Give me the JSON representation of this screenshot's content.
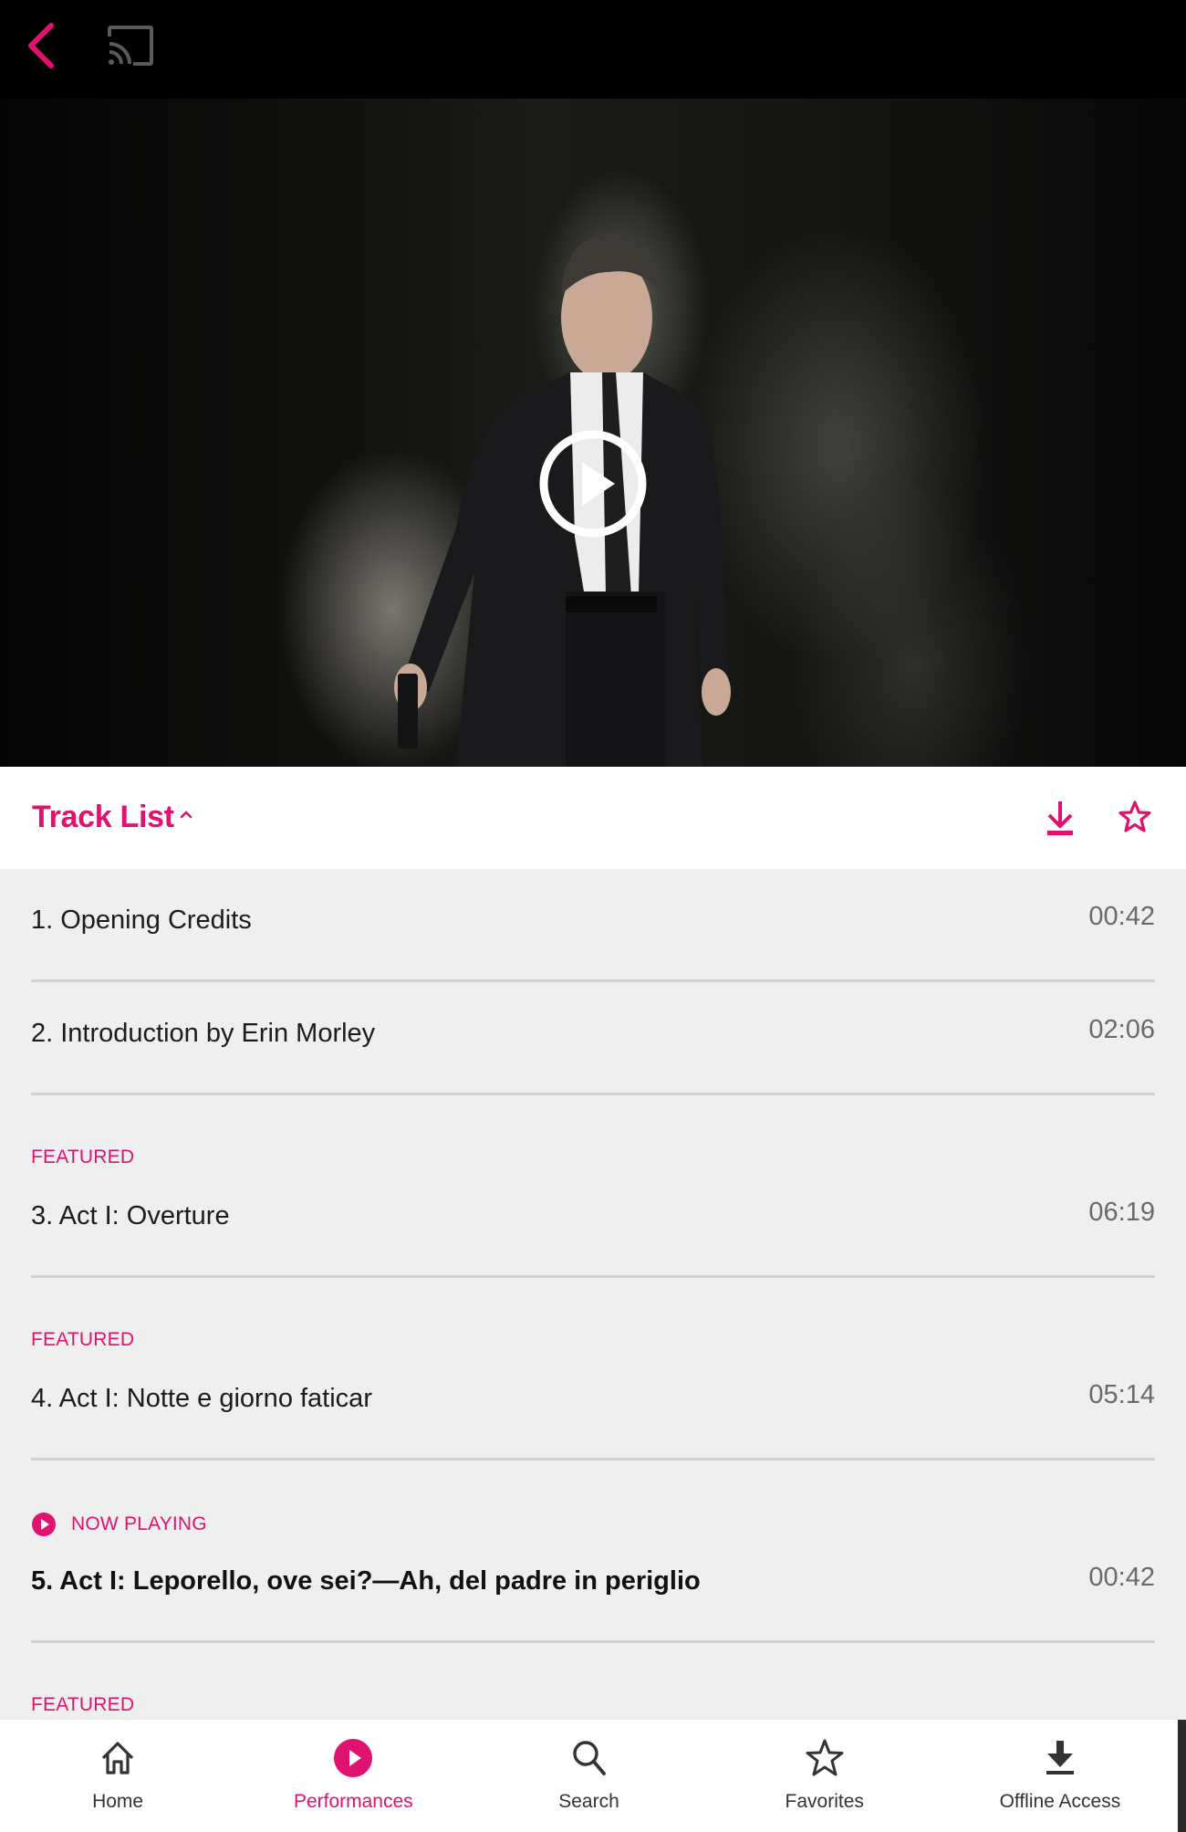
{
  "topbar": {
    "back_icon": "chevron-left-icon",
    "cast_icon": "cast-icon"
  },
  "hero": {
    "description": "Stage photo: man in dark suit holding a pistol amid smoke",
    "play_icon": "play-circle-icon"
  },
  "tracklist": {
    "title": "Track List",
    "expanded": true,
    "download_icon": "download-icon",
    "favorite_icon": "star-outline-icon",
    "tracks": [
      {
        "label": "1. Opening Credits",
        "duration": "00:42",
        "tag": ""
      },
      {
        "label": "2. Introduction by Erin Morley",
        "duration": "02:06",
        "tag": ""
      },
      {
        "label": "3. Act I: Overture",
        "duration": "06:19",
        "tag": "Featured"
      },
      {
        "label": "4. Act I: Notte e giorno faticar",
        "duration": "05:14",
        "tag": "Featured"
      },
      {
        "label": "5. Act I: Leporello, ove sei?—Ah, del padre in periglio",
        "duration": "00:42",
        "tag": "Now Playing",
        "now_playing": true
      },
      {
        "label": "",
        "duration": "",
        "tag": "Featured"
      }
    ]
  },
  "bottom_nav": {
    "items": [
      {
        "label": "Home",
        "icon": "home-icon",
        "active": false
      },
      {
        "label": "Performances",
        "icon": "play-circle-filled-icon",
        "active": true
      },
      {
        "label": "Search",
        "icon": "search-icon",
        "active": false
      },
      {
        "label": "Favorites",
        "icon": "star-outline-icon",
        "active": false
      },
      {
        "label": "Offline Access",
        "icon": "download-icon",
        "active": false
      }
    ]
  },
  "colors": {
    "accent": "#e0126f",
    "list_background": "#efefef",
    "topbar": "#000000",
    "duration_text": "#6a6a6a"
  }
}
